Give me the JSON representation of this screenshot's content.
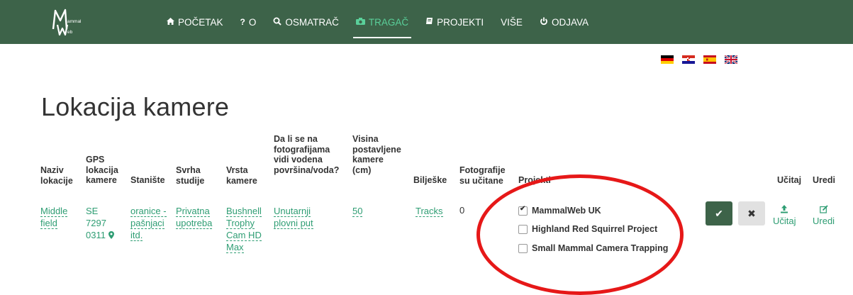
{
  "nav": {
    "logo": "MammalWeb",
    "items": [
      {
        "label": "POČETAK",
        "icon": "home-icon",
        "glyph": "🏠"
      },
      {
        "label": "O",
        "icon": "question-icon",
        "glyph": "?"
      },
      {
        "label": "OSMATRAČ",
        "icon": "search-icon",
        "glyph": "🔍"
      },
      {
        "label": "TRAGAČ",
        "icon": "camera-icon",
        "glyph": "📷"
      },
      {
        "label": "PROJEKTI",
        "icon": "book-icon",
        "glyph": "📘"
      },
      {
        "label": "VIŠE",
        "icon": "",
        "glyph": ""
      },
      {
        "label": "ODJAVA",
        "icon": "power-icon",
        "glyph": "⏻"
      }
    ],
    "active": "TRAGAČ"
  },
  "flags": [
    "German flag",
    "Croatian flag",
    "Spanish flag",
    "UK flag"
  ],
  "page": {
    "title": "Lokacija kamere"
  },
  "table": {
    "headers": {
      "naziv": "Naziv\nlokacije",
      "gps": "GPS\nlokacija\nkamere",
      "staniste": "Stanište",
      "svrha": "Svrha\nstudije",
      "vrsta": "Vrsta\nkamere",
      "voda": "Da li se na\nfotografijama\nvidi vodena\npovršina/voda?",
      "visina": "Visina\npostavljene\nkamere\n(cm)",
      "biljeske": "Bilješke",
      "fotografije": "Fotografije\nsu učitane",
      "projekti": "Projekti",
      "ucitaj": "Učitaj",
      "uredi": "Uredi"
    },
    "row": {
      "naziv": "Middle field",
      "gps_lines": [
        "SE",
        "7297",
        "0311"
      ],
      "staniste": "oranice - pašnjaci itd.",
      "svrha": "Privatna upotreba",
      "vrsta": "Bushnell Trophy Cam HD Max",
      "voda": "Unutarnji plovni put",
      "visina": "50",
      "biljeske": "Tracks",
      "fotografije": "0",
      "projects": [
        {
          "label": "MammalWeb UK",
          "checked": true
        },
        {
          "label": "Highland Red Squirrel Project",
          "checked": false
        },
        {
          "label": "Small Mammal Camera Trapping",
          "checked": false
        }
      ],
      "ok_glyph": "✔",
      "cancel_glyph": "✖",
      "ucitaj_label": "Učitaj",
      "uredi_label": "Uredi"
    }
  },
  "colors": {
    "navbar": "#3d6349",
    "active": "#5ad09a",
    "link": "#2e9d73",
    "annotation": "#e61818"
  }
}
